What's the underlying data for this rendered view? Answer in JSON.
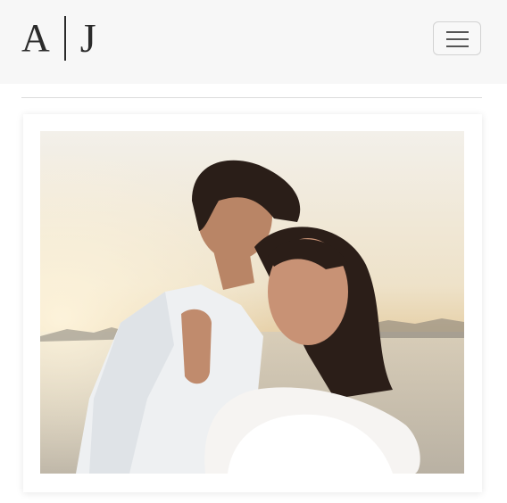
{
  "header": {
    "logo": {
      "left": "A",
      "right": "J"
    },
    "menu_toggle_icon": "hamburger-icon"
  },
  "gallery": {
    "photo_subject": "engagement-couple-photo"
  },
  "colors": {
    "navbar_bg": "#f7f7f7",
    "logo": "#2b2b2b",
    "divider": "#dcdcdc"
  }
}
